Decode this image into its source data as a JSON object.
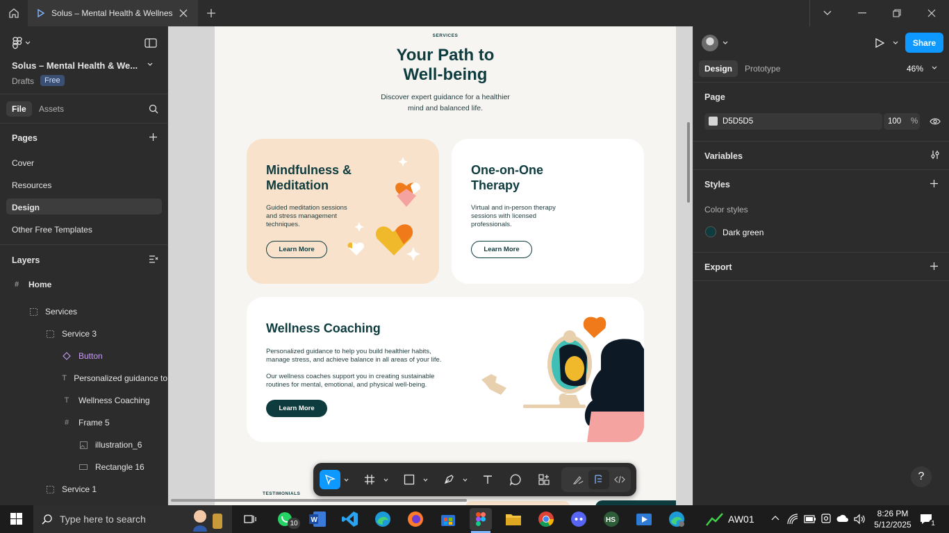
{
  "window": {
    "tab_title": "Solus – Mental Health & Wellness",
    "icons": [
      "home-icon",
      "figma-file-icon",
      "close-icon",
      "plus-icon",
      "chevron-down-icon",
      "minimize-icon",
      "maximize-icon",
      "close-window-icon"
    ]
  },
  "left_panel": {
    "file_name": "Solus – Mental Health & We...",
    "drafts_label": "Drafts",
    "plan_badge": "Free",
    "tabs": {
      "file": "File",
      "assets": "Assets"
    },
    "pages_header": "Pages",
    "pages": [
      {
        "label": "Cover"
      },
      {
        "label": "Resources"
      },
      {
        "label": "Design"
      },
      {
        "label": "Other Free Templates"
      }
    ],
    "layers_header": "Layers",
    "layers": [
      {
        "label": "Home",
        "icon": "frame-icon"
      },
      {
        "label": "Services",
        "icon": "section-icon"
      },
      {
        "label": "Service 3",
        "icon": "section-icon"
      },
      {
        "label": "Button",
        "icon": "component-icon"
      },
      {
        "label": "Personalized guidance to",
        "icon": "text-icon"
      },
      {
        "label": "Wellness Coaching",
        "icon": "text-icon"
      },
      {
        "label": "Frame 5",
        "icon": "frame-icon"
      },
      {
        "label": "illustration_6",
        "icon": "image-icon"
      },
      {
        "label": "Rectangle 16",
        "icon": "rectangle-icon"
      },
      {
        "label": "Service 1",
        "icon": "section-icon"
      }
    ]
  },
  "canvas": {
    "section_label": "SERVICES",
    "heading_line1": "Your Path to",
    "heading_line2": "Well-being",
    "subheading_line1": "Discover expert guidance for a healthier",
    "subheading_line2": "mind and balanced life.",
    "card1": {
      "title_line1": "Mindfulness &",
      "title_line2": "Meditation",
      "text_line1": "Guided meditation sessions",
      "text_line2": "and stress management",
      "text_line3": "techniques.",
      "button": "Learn More"
    },
    "card2": {
      "title_line1": "One-on-One",
      "title_line2": "Therapy",
      "text_line1": "Virtual and in-person therapy",
      "text_line2": "sessions with licensed",
      "text_line3": "professionals.",
      "button": "Learn More"
    },
    "card3": {
      "title": "Wellness Coaching",
      "para1_line1": "Personalized guidance to help you build healthier habits,",
      "para1_line2": "manage stress, and achieve balance in all areas of your life.",
      "para2_line1": "Our wellness coaches support you in creating sustainable",
      "para2_line2": "routines for mental, emotional, and physical well-being.",
      "button": "Learn More"
    },
    "next_section_label": "TESTIMONIALS",
    "colors": {
      "dark_green": "#0d3b3e",
      "peach": "#f8e2cb",
      "orange": "#f07a1a",
      "canvas_bg": "#d5d5d5"
    }
  },
  "toolbar": {
    "tools": [
      "move-tool-icon",
      "frame-tool-icon",
      "shape-tool-icon",
      "pen-tool-icon",
      "text-tool-icon",
      "comment-tool-icon",
      "actions-icon",
      "draw-mode-icon",
      "design-mode-icon",
      "dev-mode-icon"
    ]
  },
  "right_panel": {
    "tabs": {
      "design": "Design",
      "prototype": "Prototype"
    },
    "zoom": "46%",
    "share_button": "Share",
    "page_header": "Page",
    "page_color_hex": "D5D5D5",
    "page_opacity": "100",
    "percent_sign": "%",
    "variables_header": "Variables",
    "styles_header": "Styles",
    "color_styles_label": "Color styles",
    "color_style_name": "Dark green",
    "color_style_value": "#0d3b3e",
    "export_header": "Export",
    "help_label": "?"
  },
  "taskbar": {
    "search_placeholder": "Type here to search",
    "whatsapp_badge": "10",
    "weather_label": "AW01",
    "time": "8:26 PM",
    "date": "5/12/2025",
    "notification_count": "1"
  }
}
